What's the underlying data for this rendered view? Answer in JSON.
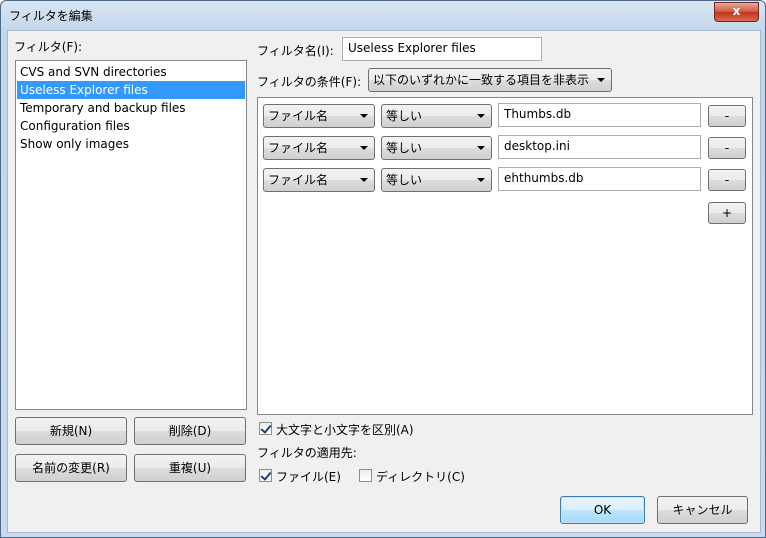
{
  "window": {
    "title": "フィルタを編集",
    "close_label": "x"
  },
  "left": {
    "list_label": "フィルタ(F):",
    "items": [
      {
        "label": "CVS and SVN directories"
      },
      {
        "label": "Useless Explorer files"
      },
      {
        "label": "Temporary and backup files"
      },
      {
        "label": "Configuration files"
      },
      {
        "label": "Show only images"
      }
    ],
    "selected_index": 1,
    "buttons": {
      "new": "新規(N)",
      "delete": "削除(D)",
      "rename": "名前の変更(R)",
      "duplicate": "重複(U)"
    }
  },
  "right": {
    "name_label": "フィルタ名(I):",
    "name_value": "Useless Explorer files",
    "condition_label": "フィルタの条件(F):",
    "condition_value": "以下のいずれかに一致する項目を非表示",
    "rules": [
      {
        "field": "ファイル名",
        "operator": "等しい",
        "value": "Thumbs.db",
        "remove_label": "-"
      },
      {
        "field": "ファイル名",
        "operator": "等しい",
        "value": "desktop.ini",
        "remove_label": "-"
      },
      {
        "field": "ファイル名",
        "operator": "等しい",
        "value": "ehthumbs.db",
        "remove_label": "-"
      }
    ],
    "add_label": "+",
    "case_sensitive": {
      "label": "大文字と小文字を区別(A)",
      "checked": true
    },
    "apply_label": "フィルタの適用先:",
    "apply_files": {
      "label": "ファイル(E)",
      "checked": true
    },
    "apply_dirs": {
      "label": "ディレクトリ(C)",
      "checked": false
    }
  },
  "footer": {
    "ok": "OK",
    "cancel": "キャンセル"
  }
}
